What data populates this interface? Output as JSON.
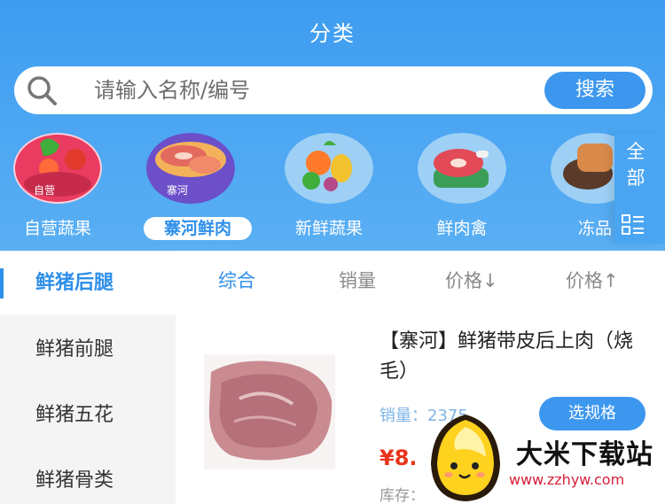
{
  "header": {
    "title": "分类"
  },
  "search": {
    "placeholder": "请输入名称/编号",
    "button_label": "搜索"
  },
  "categories": [
    {
      "label": "自营蔬果",
      "tag": "自营"
    },
    {
      "label": "寨河鲜肉",
      "tag": "寨河",
      "active": true
    },
    {
      "label": "新鲜蔬果"
    },
    {
      "label": "鲜肉禽"
    },
    {
      "label": "冻品"
    }
  ],
  "all_panel": {
    "label": "全部"
  },
  "side_menu": [
    "鲜猪后腿",
    "鲜猪前腿",
    "鲜猪五花",
    "鲜猪骨类"
  ],
  "sort_tabs": [
    "综合",
    "销量",
    "价格↓",
    "价格↑"
  ],
  "product": {
    "title": "【寨河】鲜猪带皮后上肉（烧毛）",
    "sales_label": "销量：",
    "sales_value": "2375",
    "spec_button": "选规格",
    "price": "¥8.",
    "stock_label": "库存："
  },
  "watermark": {
    "title": "大米下载站",
    "url": "www.zzhyw.com"
  },
  "colors": {
    "accent": "#2f8fe9",
    "header": "#4aa5f2",
    "price": "#e8341c"
  }
}
